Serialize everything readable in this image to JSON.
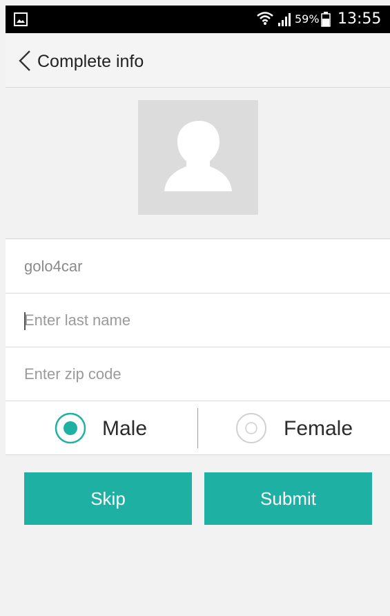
{
  "status_bar": {
    "battery_percent": "59%",
    "time": "13:55",
    "icons": [
      "gallery-icon",
      "wifi-icon",
      "signal-icon",
      "battery-icon"
    ]
  },
  "header": {
    "title": "Complete info",
    "back_icon": "chevron-left-icon"
  },
  "avatar": {
    "icon": "user-silhouette-icon"
  },
  "form": {
    "username_value": "golo4car",
    "last_name_placeholder": "Enter last name",
    "zip_placeholder": "Enter zip code"
  },
  "gender": {
    "male_label": "Male",
    "female_label": "Female",
    "selected": "Male"
  },
  "buttons": {
    "skip_label": "Skip",
    "submit_label": "Submit"
  },
  "colors": {
    "accent": "#1fb0a4",
    "status_bar": "#000000",
    "background": "#f2f2f2"
  }
}
